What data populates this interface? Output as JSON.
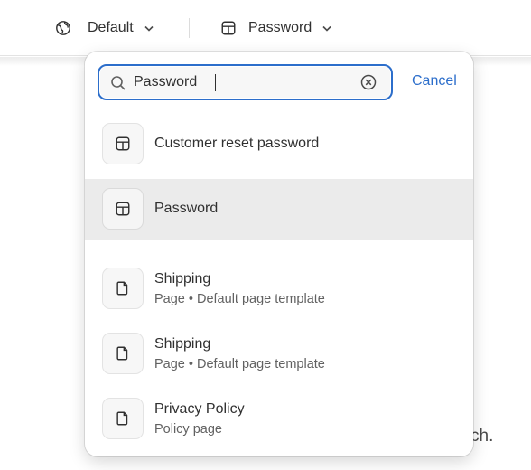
{
  "topbar": {
    "theme_selector": {
      "label": "Default",
      "icon": "globe-icon",
      "chevron": "chevron-down-icon"
    },
    "template_selector": {
      "label": "Password",
      "icon": "layout-icon",
      "chevron": "chevron-down-icon"
    }
  },
  "background": {
    "partial_text": "ch."
  },
  "search": {
    "value": "Password",
    "icon": "search-icon",
    "clear_icon": "clear-icon",
    "cancel_label": "Cancel"
  },
  "results": {
    "templates": [
      {
        "title": "Customer reset password",
        "icon": "layout-icon",
        "selected": false
      },
      {
        "title": "Password",
        "icon": "layout-icon",
        "selected": true
      }
    ],
    "pages": [
      {
        "title": "Shipping",
        "subtitle": "Page • Default page template",
        "icon": "page-icon"
      },
      {
        "title": "Shipping",
        "subtitle": "Page • Default page template",
        "icon": "page-icon"
      },
      {
        "title": "Privacy Policy",
        "subtitle": "Policy page",
        "icon": "page-icon"
      }
    ]
  },
  "colors": {
    "accent": "#2c6ecb",
    "text": "#303030",
    "subtext": "#616161",
    "selected_row": "#ebebeb"
  }
}
